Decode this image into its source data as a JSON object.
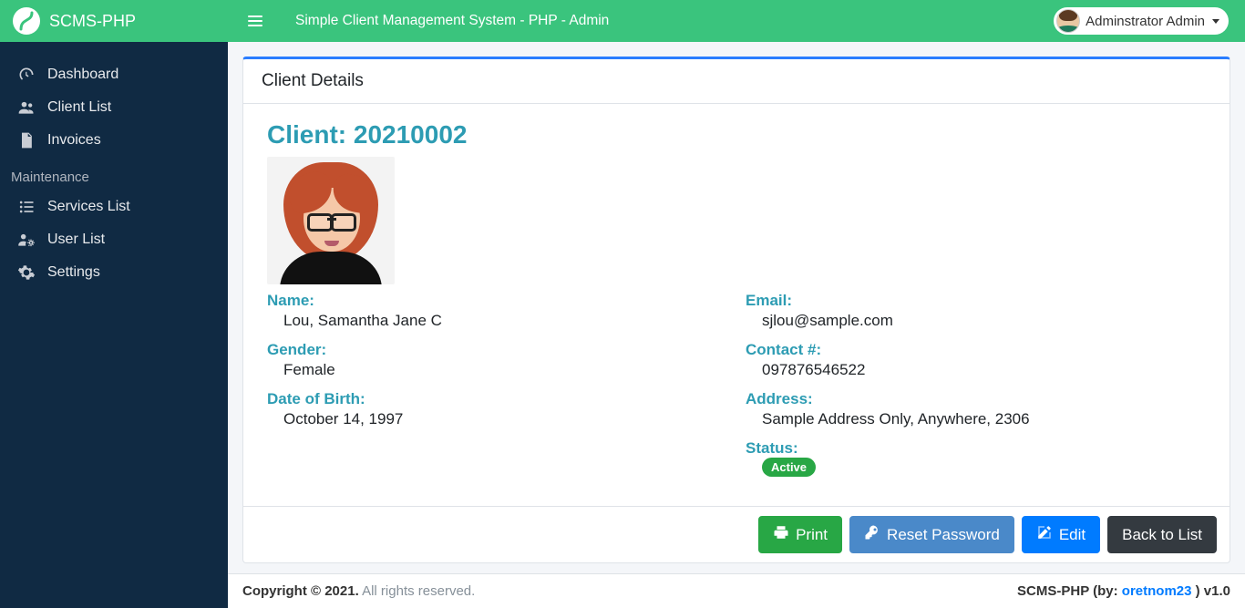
{
  "brand": {
    "name": "SCMS-PHP"
  },
  "navbar": {
    "title": "Simple Client Management System - PHP - Admin",
    "user_name": "Adminstrator Admin"
  },
  "sidebar": {
    "items": [
      {
        "label": "Dashboard"
      },
      {
        "label": "Client List"
      },
      {
        "label": "Invoices"
      }
    ],
    "maintenance_header": "Maintenance",
    "maintenance_items": [
      {
        "label": "Services List"
      },
      {
        "label": "User List"
      },
      {
        "label": "Settings"
      }
    ]
  },
  "page": {
    "card_title": "Client Details",
    "client_heading": "Client: 20210002",
    "left": {
      "name_label": "Name:",
      "name_value": "Lou, Samantha Jane C",
      "gender_label": "Gender:",
      "gender_value": "Female",
      "dob_label": "Date of Birth:",
      "dob_value": "October 14, 1997"
    },
    "right": {
      "email_label": "Email:",
      "email_value": "sjlou@sample.com",
      "contact_label": "Contact #:",
      "contact_value": "097876546522",
      "address_label": "Address:",
      "address_value": "Sample Address Only, Anywhere, 2306",
      "status_label": "Status:",
      "status_value": "Active"
    },
    "buttons": {
      "print": "Print",
      "reset": "Reset Password",
      "edit": "Edit",
      "back": "Back to List"
    }
  },
  "footer": {
    "copyright_strong": "Copyright © 2021.",
    "copyright_rest": " All rights reserved.",
    "right_prefix": "SCMS-PHP (by: ",
    "right_link": "oretnom23",
    "right_suffix": " ) v1.0"
  }
}
